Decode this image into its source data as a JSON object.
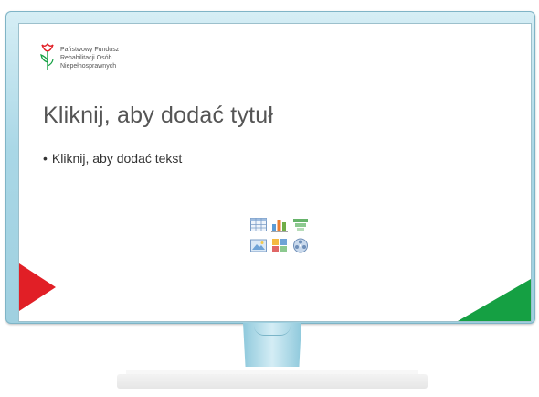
{
  "logo": {
    "icon": "pfron-tulip-logo",
    "lines": [
      "Państwowy Fundusz",
      "Rehabilitacji Osób",
      "Niepełnosprawnych"
    ]
  },
  "slide": {
    "title_placeholder": "Kliknij, aby dodać tytuł",
    "bullet_placeholder": "Kliknij, aby dodać tekst",
    "bullet_char": "•"
  },
  "content_icons": [
    "insert-table-icon",
    "insert-chart-icon",
    "insert-smartart-icon",
    "insert-picture-icon",
    "insert-clipart-icon",
    "insert-media-icon"
  ],
  "colors": {
    "accent_red": "#e11f26",
    "accent_green": "#15a043",
    "frame": "#a9d7e6"
  }
}
